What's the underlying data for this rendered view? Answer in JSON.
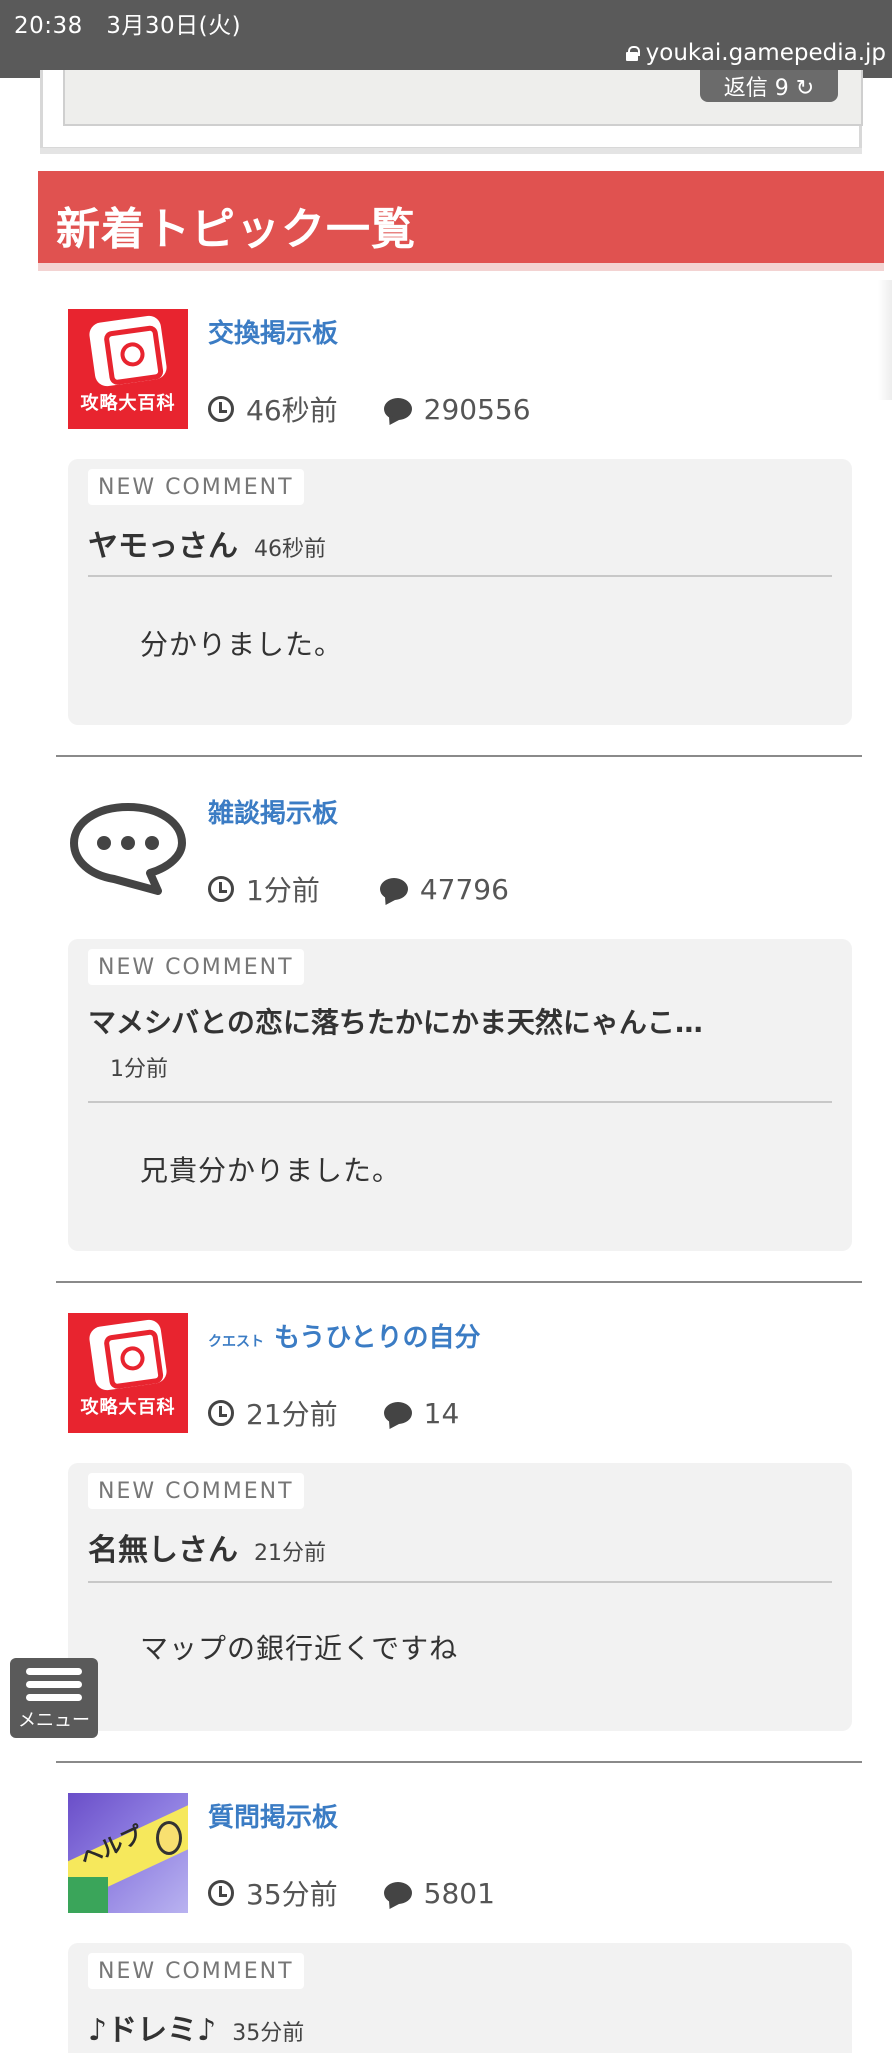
{
  "status_bar": {
    "time": "20:38　3月30日(火)",
    "url": "youkai.gamepedia.jp"
  },
  "prev_card": {
    "reply_label": "返信 9 ↻"
  },
  "section": {
    "title": "新着トピック一覧"
  },
  "topics": [
    {
      "thumb": "攻略大百科",
      "prefix": "",
      "title": "交換掲示板",
      "time": "46秒前",
      "count": "290556",
      "badge": "NEW COMMENT",
      "author": "ヤモっさん",
      "author_time": "46秒前",
      "text": "分かりました。"
    },
    {
      "thumb": "chat",
      "prefix": "",
      "title": "雑談掲示板",
      "time": "1分前",
      "count": "47796",
      "badge": "NEW COMMENT",
      "author": "マメシバとの恋に落ちたかにかま天然にゃんこ…",
      "author_time": "1分前",
      "text": "兄貴分かりました。"
    },
    {
      "thumb": "攻略大百科",
      "prefix": "クエスト",
      "title": "もうひとりの自分",
      "time": "21分前",
      "count": "14",
      "badge": "NEW COMMENT",
      "author": "名無しさん",
      "author_time": "21分前",
      "text": "マップの銀行近くですね"
    },
    {
      "thumb": "ヘルプ",
      "prefix": "",
      "title": "質問掲示板",
      "time": "35分前",
      "count": "5801",
      "badge": "NEW COMMENT",
      "author": "♪ドレミ♪",
      "author_time": "35分前",
      "text": ""
    }
  ],
  "menu": {
    "label": "メニュー"
  },
  "colors": {
    "accent": "#e05250",
    "link": "#3b7cc4",
    "status_bar": "#5a5a5a"
  }
}
